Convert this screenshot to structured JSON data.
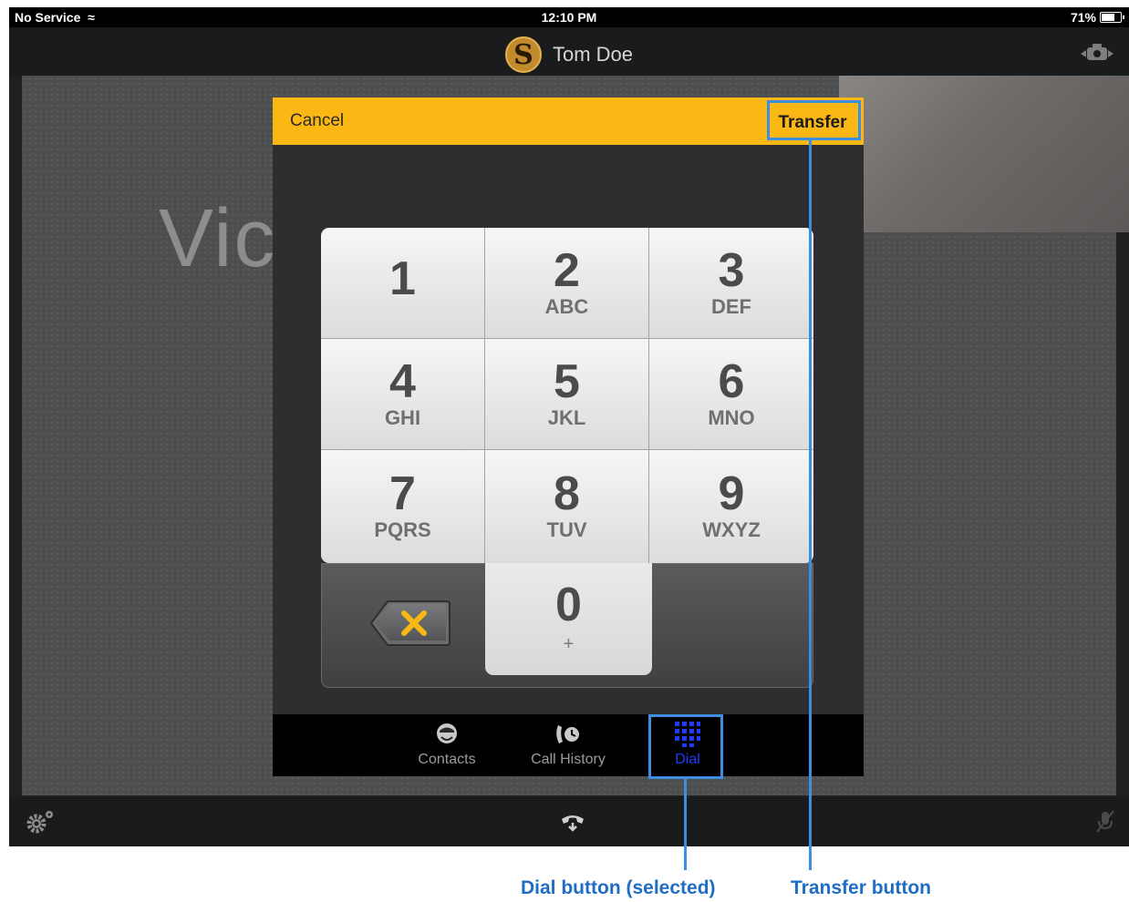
{
  "status_bar": {
    "carrier": "No Service",
    "time": "12:10 PM",
    "battery": "71%"
  },
  "title_bar": {
    "caller_name": "Tom Doe",
    "logo_letter": "S"
  },
  "video": {
    "placeholder_text": "Vic                                        bled"
  },
  "dialog": {
    "cancel_label": "Cancel",
    "transfer_label": "Transfer",
    "keys": [
      {
        "num": "1",
        "letters": ""
      },
      {
        "num": "2",
        "letters": "ABC"
      },
      {
        "num": "3",
        "letters": "DEF"
      },
      {
        "num": "4",
        "letters": "GHI"
      },
      {
        "num": "5",
        "letters": "JKL"
      },
      {
        "num": "6",
        "letters": "MNO"
      },
      {
        "num": "7",
        "letters": "PQRS"
      },
      {
        "num": "8",
        "letters": "TUV"
      },
      {
        "num": "9",
        "letters": "WXYZ"
      }
    ],
    "zero": {
      "num": "0",
      "sub": "+"
    },
    "tabs": [
      {
        "label": "Contacts",
        "icon": "contacts-icon"
      },
      {
        "label": "Call History",
        "icon": "call-history-icon"
      },
      {
        "label": "Dial",
        "icon": "dial-icon",
        "selected": true
      }
    ]
  },
  "colors": {
    "header_yellow": "#fbb714",
    "selected_tab": "#1e3cff",
    "callout": "#3b8ee0"
  },
  "callouts": {
    "dial": "Dial button (selected)",
    "transfer": "Transfer button"
  }
}
